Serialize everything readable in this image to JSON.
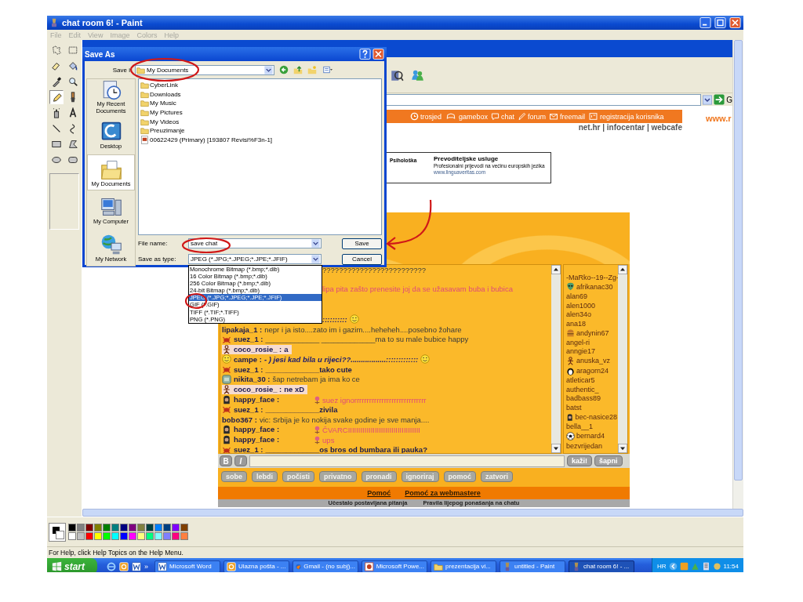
{
  "window": {
    "title": "chat room 6! - Paint"
  },
  "menu": [
    {
      "label": "File",
      "disabled": true
    },
    {
      "label": "Edit",
      "disabled": true
    },
    {
      "label": "View",
      "disabled": true
    },
    {
      "label": "Image",
      "disabled": true
    },
    {
      "label": "Colors",
      "disabled": true
    },
    {
      "label": "Help",
      "disabled": true
    }
  ],
  "tools": [
    {
      "kind": "free-select",
      "selected": false
    },
    {
      "kind": "rect-select",
      "selected": false
    },
    {
      "kind": "eraser",
      "selected": false
    },
    {
      "kind": "fill",
      "selected": false
    },
    {
      "kind": "picker",
      "selected": false
    },
    {
      "kind": "magnifier",
      "selected": false
    },
    {
      "kind": "pencil",
      "selected": true
    },
    {
      "kind": "brush",
      "selected": false
    },
    {
      "kind": "airbrush",
      "selected": false
    },
    {
      "kind": "text",
      "selected": false
    },
    {
      "kind": "line",
      "selected": false
    },
    {
      "kind": "curve",
      "selected": false
    },
    {
      "kind": "rectangle",
      "selected": false
    },
    {
      "kind": "polygon",
      "selected": false
    },
    {
      "kind": "ellipse",
      "selected": false
    },
    {
      "kind": "rounded-rectangle",
      "selected": false
    }
  ],
  "browser": {
    "address_go": "G",
    "nav": [
      "trosjed",
      "gamebox",
      "chat",
      "forum",
      "freemail",
      "registracija korisnika"
    ],
    "site": "www.r",
    "links": "net.hr | infocentar | webcafe",
    "ad": {
      "cut_text": "Psihološka",
      "title": "Prevoditeljske usluge",
      "text": "Profesionalni prijevodi na većinu europskih jezika",
      "url": "www.linguaveritas.com"
    },
    "chat": {
      "messages": [
        {
          "kind": "plain",
          "text": "?????????????????????????",
          "highlighted": false
        },
        {
          "kind": "pink",
          "text": "lipa pita zašto prenesite joj da se užasavam buba i bubica",
          "highlighted": false
        },
        {
          "kind": "italic",
          "text": "::::::::::",
          "highlighted": false
        },
        {
          "kind": "plain",
          "nick": "lipakaja_1 :",
          "text": "nepr i ja isto....zato im i gazim....heheheh....posebno žohare",
          "highlighted": false
        },
        {
          "kind": "plain",
          "nick": "suez_1 :",
          "text": "_____________ _____________ma to su male bubice happy",
          "highlighted": false
        },
        {
          "kind": "bold",
          "nick": "coco_rosie_ :",
          "text": "a",
          "highlighted": true
        },
        {
          "kind": "italic",
          "nick": "campe :",
          "text": "- ) jesi kad bila u rijeci??.................:::::::::::::",
          "highlighted": false
        },
        {
          "kind": "bold",
          "nick": "suez_1 :",
          "text": "_____________tako cute",
          "highlighted": false
        },
        {
          "kind": "plain",
          "nick": "nikita_30 :",
          "text": "šap netrebam ja ima ko ce",
          "highlighted": false
        },
        {
          "kind": "bold",
          "nick": "coco_rosie_ :",
          "text": "ne xD",
          "highlighted": true
        },
        {
          "kind": "pink",
          "nick": "happy_face :",
          "text": "suez ignorrrrrrrrrrrrrrrrrrrrrrrrrrrrr",
          "highlighted": false
        },
        {
          "kind": "bold",
          "nick": "suez_1 :",
          "text": "_____________zivila",
          "highlighted": false
        },
        {
          "kind": "plain",
          "nick": "bobo367 :",
          "text": "vic: Srbija je ko nokija svake godine je sve manja....",
          "highlighted": false
        },
        {
          "kind": "pink",
          "nick": "happy_face :",
          "text": "ČVARCIIIIIIIIIIIIIIIIIIIIIIIIIIIIIIIIIII",
          "highlighted": false
        },
        {
          "kind": "pink",
          "nick": "happy_face :",
          "text": "ups",
          "highlighted": false
        },
        {
          "kind": "bold",
          "nick": "suez_1 :",
          "text": "_____________os bros od bumbara ili pauka?",
          "highlighted": false
        }
      ],
      "users": [
        "-MaRko--19--Zg-",
        "afrikanac30",
        "alan69",
        "alen1000",
        "alen34o",
        "ana18",
        "andynin67",
        "angel-ri",
        "anngie17",
        "anuska_vz",
        "aragorn24",
        "atleticar5",
        "authentic_",
        "badbass89",
        "batst",
        "bec-nasice28",
        "bella__1",
        "bernard4",
        "bezvrijedan"
      ],
      "format_buttons": [
        "B",
        "I"
      ],
      "send_buttons": [
        "kaži!",
        "šapni"
      ],
      "actions": [
        "sobe",
        "lebdi",
        "počisti",
        "privatno",
        "pronadi",
        "ignoriraj",
        "pomoć",
        "zatvori"
      ],
      "footer_links": [
        "Pomoć",
        "Pomoć za webmastere"
      ],
      "bottom_links": [
        "Učestalo postavljana pitanja",
        "Pravila lijepog ponašanja na chatu"
      ]
    }
  },
  "dialog": {
    "title": "Save As",
    "save_in_label": "Save i",
    "save_in": "My Documents",
    "places": [
      {
        "label": "My Recent Documents",
        "selected": false
      },
      {
        "label": "Desktop",
        "selected": false
      },
      {
        "label": "My Documents",
        "selected": true
      },
      {
        "label": "My Computer",
        "selected": false
      },
      {
        "label": "My Network",
        "selected": false
      }
    ],
    "files": [
      {
        "name": "CyberLink",
        "kind": "folder"
      },
      {
        "name": "Downloads",
        "kind": "folder"
      },
      {
        "name": "My Music",
        "kind": "folder"
      },
      {
        "name": "My Pictures",
        "kind": "folder"
      },
      {
        "name": "My Videos",
        "kind": "folder"
      },
      {
        "name": "Preuzimanje",
        "kind": "folder"
      },
      {
        "name": "00622429 (Primary) [193807 Revisi%F3n-1]",
        "kind": "document"
      }
    ],
    "file_name_label": "File name:",
    "file_name": "save chat",
    "type_label": "Save as type:",
    "type": "JPEG (*.JPG;*.JPEG;*.JPE;*.JFIF)",
    "save": "Save",
    "cancel": "Cancel",
    "type_options": [
      {
        "label": "Monochrome Bitmap (*.bmp;*.dib)",
        "selected": false
      },
      {
        "label": "16 Color Bitmap (*.bmp;*.dib)",
        "selected": false
      },
      {
        "label": "256 Color Bitmap (*.bmp;*.dib)",
        "selected": false
      },
      {
        "label": "24-bit Bitmap (*.bmp;*.dib)",
        "selected": false
      },
      {
        "label": "JPEG (*.JPG;*.JPEG;*.JPE;*.JFIF)",
        "selected": true
      },
      {
        "label": "GIF (*.GIF)",
        "selected": false
      },
      {
        "label": "TIFF (*.TIF;*.TIFF)",
        "selected": false
      },
      {
        "label": "PNG (*.PNG)",
        "selected": false
      }
    ]
  },
  "palette": [
    {
      "color": "#000000"
    },
    {
      "color": "#808080"
    },
    {
      "color": "#800000"
    },
    {
      "color": "#808000"
    },
    {
      "color": "#008000"
    },
    {
      "color": "#008080"
    },
    {
      "color": "#000080"
    },
    {
      "color": "#800080"
    },
    {
      "color": "#808040"
    },
    {
      "color": "#004040"
    },
    {
      "color": "#0080ff"
    },
    {
      "color": "#004080"
    },
    {
      "color": "#8000ff"
    },
    {
      "color": "#804000"
    },
    {
      "color": "#ffffff"
    },
    {
      "color": "#c0c0c0"
    },
    {
      "color": "#ff0000"
    },
    {
      "color": "#ffff00"
    },
    {
      "color": "#00ff00"
    },
    {
      "color": "#00ffff"
    },
    {
      "color": "#0000ff"
    },
    {
      "color": "#ff00ff"
    },
    {
      "color": "#ffff80"
    },
    {
      "color": "#00ff80"
    },
    {
      "color": "#80ffff"
    },
    {
      "color": "#8080ff"
    },
    {
      "color": "#ff0080"
    },
    {
      "color": "#ff8040"
    }
  ],
  "status_bar": "For Help, click Help Topics on the Help Menu.",
  "taskbar": {
    "start": "start",
    "more": "»",
    "tasks": [
      {
        "label": "Microsoft Word",
        "selected": false
      },
      {
        "label": "Ulazna pošta - ...",
        "selected": false
      },
      {
        "label": "Gmail - (no subj)...",
        "selected": false
      },
      {
        "label": "Microsoft Powe...",
        "selected": false
      },
      {
        "label": "prezentacija vi...",
        "selected": false
      },
      {
        "label": "untitled - Paint",
        "selected": false
      },
      {
        "label": "chat room 6! - ...",
        "selected": true
      }
    ],
    "language": "HR",
    "clock": "11:54"
  }
}
